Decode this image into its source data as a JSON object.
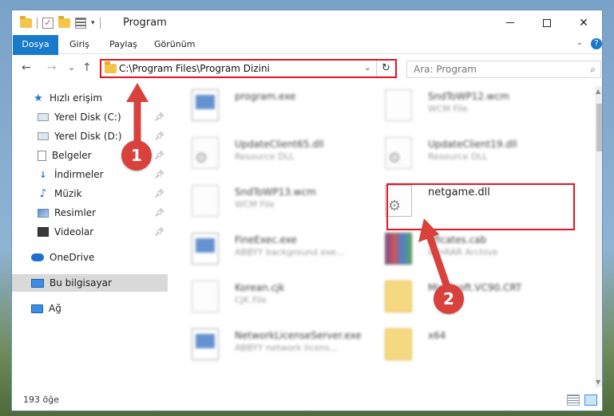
{
  "window": {
    "title": "Program",
    "controls": {
      "minimize": "—",
      "maximize": "□",
      "close": "✕"
    }
  },
  "ribbon": {
    "tabs": [
      "Dosya",
      "Giriş",
      "Paylaş",
      "Görünüm"
    ],
    "expand": "⌄",
    "help": "?"
  },
  "nav": {
    "back": "←",
    "forward": "→",
    "recent": "⌄",
    "up": "↑",
    "address": "C:\\Program Files\\Program Dizini",
    "search_placeholder": "Ara: Program"
  },
  "sidebar": {
    "items": [
      {
        "label": "Hızlı erişim",
        "icon": "star-icon"
      },
      {
        "label": "Yerel Disk (C:)",
        "icon": "drive-icon",
        "pinned": true
      },
      {
        "label": "Yerel Disk (D:)",
        "icon": "drive-icon",
        "pinned": true
      },
      {
        "label": "Belgeler",
        "icon": "document-icon",
        "pinned": true
      },
      {
        "label": "İndirmeler",
        "icon": "download-icon",
        "pinned": true
      },
      {
        "label": "Müzik",
        "icon": "music-icon",
        "pinned": true
      },
      {
        "label": "Resimler",
        "icon": "pictures-icon",
        "pinned": true
      },
      {
        "label": "Videolar",
        "icon": "video-icon",
        "pinned": true
      },
      {
        "label": "OneDrive",
        "icon": "cloud-icon"
      },
      {
        "label": "Bu bilgisayar",
        "icon": "computer-icon",
        "selected": true
      },
      {
        "label": "Ağ",
        "icon": "network-icon"
      }
    ]
  },
  "files": [
    {
      "name": "program.exe",
      "type": ""
    },
    {
      "name": "SndToWP12.wcm",
      "type": "WCM File"
    },
    {
      "name": "UpdateClient65.dll",
      "type": "Resource DLL"
    },
    {
      "name": "UpdateClient19.dll",
      "type": "Resource DLL"
    },
    {
      "name": "SndToWP13.wcm",
      "type": "WCM File"
    },
    {
      "name": "netgame.dll",
      "type": ""
    },
    {
      "name": "FineExec.exe",
      "type": "ABBYY background exe..."
    },
    {
      "name": "tificates.cab",
      "type": "WinRAR Archive"
    },
    {
      "name": "Korean.cjk",
      "type": "CJK File"
    },
    {
      "name": "Microsoft.VC90.CRT",
      "type": ""
    },
    {
      "name": "NetworkLicenseServer.exe",
      "type": "ABBYY network licens..."
    },
    {
      "name": "x64",
      "type": ""
    }
  ],
  "status": {
    "count": "193 öğe"
  },
  "annotations": {
    "marker1": "1",
    "marker2": "2"
  },
  "colors": {
    "accent": "#1979ca",
    "highlight": "#e81123",
    "marker": "#d9413c"
  }
}
